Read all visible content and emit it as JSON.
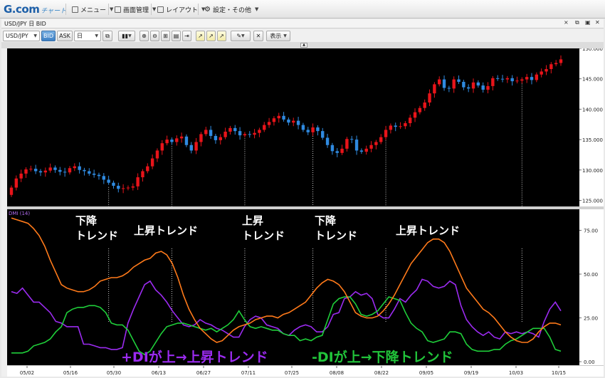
{
  "app": {
    "logo_main": "G.com",
    "logo_sub": "チャート"
  },
  "menubar": {
    "items": [
      {
        "label": "メニュー",
        "icon": "list-icon"
      },
      {
        "label": "画面管理",
        "icon": "window-icon"
      },
      {
        "label": "レイアウト",
        "icon": "layout-icon"
      },
      {
        "label": "設定・その他",
        "icon": "gear-icon"
      }
    ]
  },
  "window": {
    "title": "USD/JPY 日 BID",
    "controls": [
      "×",
      "⧉",
      "▣",
      "✕"
    ]
  },
  "toolbar": {
    "symbol": "USD/JPY",
    "bid": "BID",
    "ask": "ASK",
    "period": "日",
    "display": "表示"
  },
  "indicator": {
    "label": "DMI (14)"
  },
  "annotations": {
    "trend_down_1": [
      "下降",
      "トレンド"
    ],
    "trend_up_1": "上昇トレンド",
    "trend_up_2": [
      "上昇",
      "トレンド"
    ],
    "trend_down_2": [
      "下降",
      "トレンド"
    ],
    "trend_up_3": "上昇トレンド",
    "legend_plus": "+DIが上→上昇トレンド",
    "legend_minus": "-DIが上→下降トレンド"
  },
  "colors": {
    "up_candle": "#e8141a",
    "down_candle": "#2f8ae0",
    "plus_di": "#9b2bf0",
    "minus_di": "#1fcf3a",
    "adx": "#ff7a1a",
    "plus_text": "#9b2bf0",
    "minus_text": "#21c43a"
  },
  "chart_data": [
    {
      "type": "candlestick",
      "title": "USD/JPY 日 BID",
      "y_ticks": [
        "150.000",
        "145.000",
        "140.000",
        "135.000",
        "130.000",
        "125.000"
      ],
      "ylim": [
        124,
        150
      ],
      "x_ticks": [
        "05/02",
        "05/16",
        "05/30",
        "06/13",
        "06/27",
        "07/11",
        "07/25",
        "08/08",
        "08/22",
        "09/05",
        "09/19",
        "10/03",
        "10/15"
      ],
      "close": [
        127.1,
        128.6,
        129.4,
        130.1,
        130.2,
        129.8,
        129.6,
        129.9,
        130.4,
        130.0,
        129.7,
        129.6,
        130.3,
        130.6,
        130.0,
        129.8,
        129.4,
        129.2,
        129.0,
        128.4,
        127.9,
        127.4,
        126.9,
        127.0,
        127.1,
        127.3,
        128.8,
        129.8,
        130.6,
        131.9,
        133.2,
        134.4,
        135.0,
        134.6,
        135.2,
        135.5,
        134.1,
        133.2,
        134.6,
        135.9,
        136.6,
        135.6,
        134.9,
        135.4,
        136.3,
        136.9,
        136.4,
        135.7,
        135.9,
        135.8,
        136.1,
        136.6,
        137.4,
        137.9,
        138.5,
        138.9,
        138.3,
        137.8,
        138.1,
        137.4,
        136.6,
        136.2,
        137.0,
        136.4,
        135.3,
        134.1,
        133.1,
        132.8,
        133.5,
        135.1,
        135.0,
        133.2,
        133.0,
        133.5,
        134.1,
        134.6,
        135.4,
        136.6,
        137.3,
        137.1,
        137.2,
        137.7,
        138.6,
        139.5,
        140.2,
        141.1,
        142.6,
        144.1,
        144.9,
        143.5,
        143.4,
        144.9,
        144.5,
        143.6,
        143.4,
        144.4,
        143.9,
        143.2,
        143.8,
        145.1,
        145.0,
        144.9,
        145.1,
        144.6,
        144.7,
        144.9,
        145.3,
        144.8,
        145.7,
        146.2,
        146.6,
        147.4,
        147.6,
        148.2
      ],
      "open": [
        125.9,
        127.1,
        128.6,
        129.4,
        130.1,
        130.2,
        129.8,
        129.6,
        129.9,
        130.4,
        130.0,
        129.7,
        129.6,
        130.3,
        130.6,
        130.0,
        129.8,
        129.4,
        129.2,
        129.0,
        128.4,
        127.9,
        127.4,
        126.9,
        127.0,
        127.1,
        127.3,
        128.8,
        129.8,
        130.6,
        131.9,
        133.2,
        134.4,
        135.0,
        134.6,
        135.2,
        135.5,
        134.1,
        133.2,
        134.6,
        135.9,
        136.6,
        135.6,
        134.9,
        135.4,
        136.3,
        136.9,
        136.4,
        135.7,
        135.9,
        135.8,
        136.1,
        136.6,
        137.4,
        137.9,
        138.5,
        138.9,
        138.3,
        137.8,
        138.1,
        137.4,
        136.6,
        136.2,
        137.0,
        136.4,
        135.3,
        134.1,
        133.1,
        132.8,
        133.5,
        135.1,
        135.0,
        133.2,
        133.0,
        133.5,
        134.1,
        134.6,
        135.4,
        136.6,
        137.3,
        137.1,
        137.2,
        137.7,
        138.6,
        139.5,
        140.2,
        141.1,
        142.6,
        144.1,
        144.9,
        143.5,
        143.4,
        144.9,
        144.5,
        143.6,
        143.4,
        144.4,
        143.9,
        143.2,
        143.8,
        145.1,
        145.0,
        144.9,
        145.1,
        144.6,
        144.7,
        144.9,
        145.3,
        144.8,
        145.7,
        146.2,
        146.6,
        147.4,
        147.6
      ]
    },
    {
      "type": "line",
      "title": "DMI (14)",
      "y_ticks": [
        "75.00",
        "50.00",
        "25.00",
        "0.00"
      ],
      "ylim": [
        -2,
        87
      ],
      "series": [
        {
          "name": "+DI",
          "color": "#9b2bf0",
          "values": [
            40,
            39,
            42,
            38,
            34,
            34,
            31,
            28,
            23,
            22,
            20,
            20,
            20,
            10,
            10,
            9,
            8,
            8,
            7,
            7,
            8,
            22,
            30,
            37,
            44,
            46,
            41,
            38,
            34,
            29,
            25,
            21,
            20,
            21,
            24,
            22,
            21,
            19,
            18,
            16,
            14,
            14,
            20,
            24,
            26,
            25,
            21,
            20,
            19,
            16,
            15,
            18,
            20,
            21,
            20,
            17,
            17,
            20,
            27,
            28,
            36,
            37,
            40,
            38,
            39,
            36,
            27,
            25,
            25,
            30,
            36,
            34,
            38,
            41,
            47,
            46,
            43,
            42,
            43,
            46,
            44,
            32,
            24,
            20,
            17,
            15,
            17,
            14,
            13,
            17,
            16,
            17,
            16,
            17,
            16,
            14,
            23,
            30,
            34,
            29
          ]
        },
        {
          "name": "-DI",
          "color": "#1fcf3a",
          "values": [
            5,
            5,
            5,
            6,
            9,
            10,
            11,
            13,
            17,
            20,
            28,
            30,
            31,
            31,
            32,
            32,
            31,
            28,
            22,
            21,
            21,
            18,
            12,
            6,
            4,
            6,
            11,
            16,
            20,
            21,
            22,
            22,
            21,
            20,
            19,
            18,
            19,
            17,
            19,
            21,
            24,
            29,
            24,
            20,
            19,
            20,
            19,
            18,
            18,
            16,
            15,
            15,
            12,
            13,
            12,
            14,
            15,
            24,
            33,
            36,
            37,
            37,
            33,
            27,
            26,
            27,
            29,
            33,
            37,
            36,
            35,
            28,
            22,
            19,
            17,
            12,
            11,
            12,
            13,
            17,
            17,
            16,
            10,
            7,
            6,
            6,
            6,
            7,
            7,
            10,
            12,
            13,
            15,
            17,
            19,
            19,
            19,
            14,
            7,
            6
          ]
        },
        {
          "name": "ADX",
          "color": "#ff7a1a",
          "values": [
            82,
            81,
            80,
            79,
            76,
            72,
            66,
            58,
            51,
            44,
            42,
            41,
            40,
            40,
            41,
            43,
            46,
            47,
            48,
            48,
            49,
            51,
            54,
            56,
            58,
            59,
            62,
            63,
            61,
            56,
            48,
            38,
            30,
            24,
            19,
            16,
            13,
            11,
            12,
            15,
            18,
            20,
            21,
            22,
            24,
            25,
            26,
            26,
            25,
            27,
            28,
            30,
            32,
            34,
            38,
            42,
            45,
            47,
            46,
            44,
            40,
            34,
            28,
            26,
            25,
            25,
            26,
            29,
            33,
            38,
            44,
            50,
            56,
            60,
            64,
            68,
            70,
            70,
            68,
            63,
            56,
            49,
            42,
            38,
            34,
            30,
            28,
            25,
            21,
            17,
            14,
            12,
            11,
            11,
            13,
            17,
            20,
            22,
            22,
            21
          ]
        }
      ]
    }
  ]
}
